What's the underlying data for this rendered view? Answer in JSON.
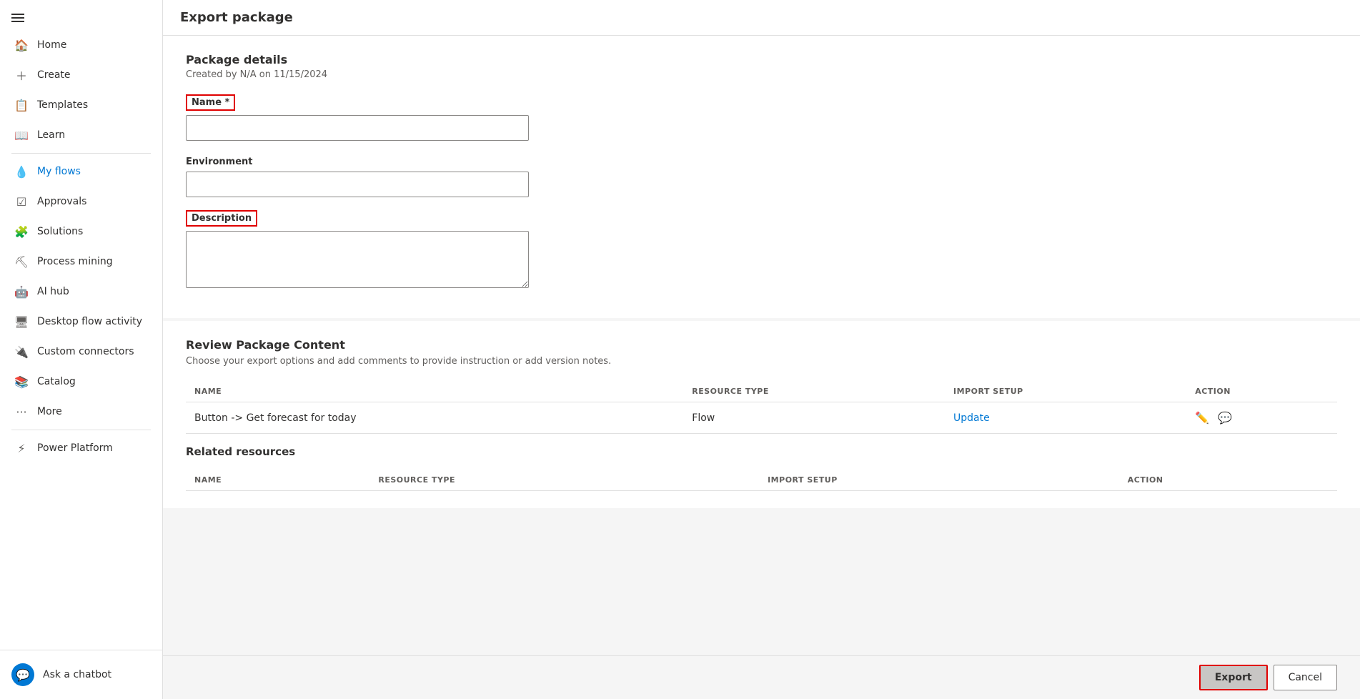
{
  "sidebar": {
    "hamburger_label": "Menu",
    "items": [
      {
        "id": "home",
        "label": "Home",
        "icon": "🏠",
        "active": false
      },
      {
        "id": "create",
        "label": "Create",
        "icon": "+",
        "active": false
      },
      {
        "id": "templates",
        "label": "Templates",
        "icon": "📄",
        "active": false
      },
      {
        "id": "learn",
        "label": "Learn",
        "icon": "📖",
        "active": false
      },
      {
        "id": "my-flows",
        "label": "My flows",
        "icon": "💧",
        "active": true
      },
      {
        "id": "approvals",
        "label": "Approvals",
        "icon": "✅",
        "active": false
      },
      {
        "id": "solutions",
        "label": "Solutions",
        "icon": "🧩",
        "active": false
      },
      {
        "id": "process-mining",
        "label": "Process mining",
        "icon": "⛏",
        "active": false
      },
      {
        "id": "ai-hub",
        "label": "AI hub",
        "icon": "🤖",
        "active": false
      },
      {
        "id": "desktop-flow-activity",
        "label": "Desktop flow activity",
        "icon": "🖥",
        "active": false
      },
      {
        "id": "custom-connectors",
        "label": "Custom connectors",
        "icon": "🔌",
        "active": false
      },
      {
        "id": "catalog",
        "label": "Catalog",
        "icon": "📚",
        "active": false
      },
      {
        "id": "more",
        "label": "More",
        "icon": "···",
        "active": false
      },
      {
        "id": "power-platform",
        "label": "Power Platform",
        "icon": "⚡",
        "active": false
      }
    ],
    "chatbot_label": "Ask a chatbot"
  },
  "page": {
    "title": "Export package"
  },
  "package_details": {
    "section_title": "Package details",
    "subtitle": "Created by N/A on 11/15/2024",
    "name_label": "Name *",
    "name_value": "",
    "name_placeholder": "",
    "environment_label": "Environment",
    "environment_value": "",
    "description_label": "Description",
    "description_value": ""
  },
  "review_package": {
    "section_title": "Review Package Content",
    "subtitle": "Choose your export options and add comments to provide instruction or add version notes.",
    "table_headers": {
      "name": "NAME",
      "resource_type": "RESOURCE TYPE",
      "import_setup": "IMPORT SETUP",
      "action": "ACTION"
    },
    "rows": [
      {
        "name": "Button -> Get forecast for today",
        "resource_type": "Flow",
        "import_setup": "Update",
        "import_setup_link": true
      }
    ],
    "related_resources_title": "Related resources",
    "related_headers": {
      "name": "NAME",
      "resource_type": "RESOURCE TYPE",
      "import_setup": "IMPORT SETUP",
      "action": "ACTION"
    }
  },
  "footer": {
    "export_label": "Export",
    "cancel_label": "Cancel"
  }
}
